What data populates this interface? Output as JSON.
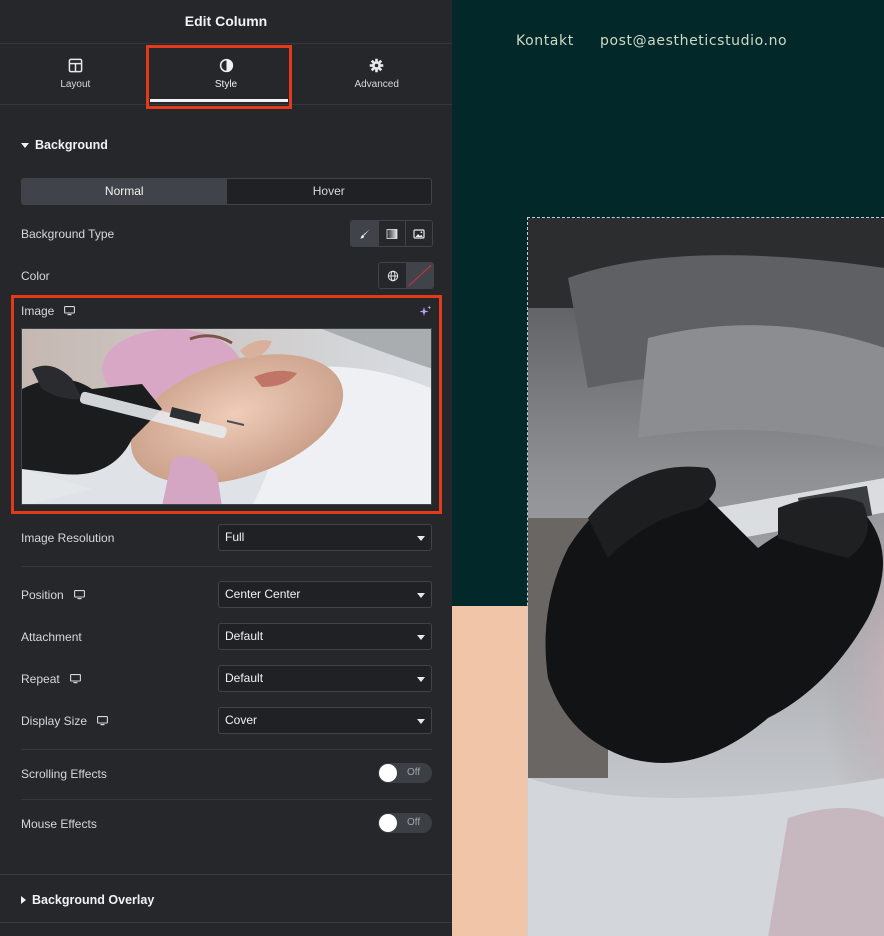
{
  "panel": {
    "title": "Edit Column",
    "tabs": [
      {
        "label": "Layout",
        "icon": "layout-icon"
      },
      {
        "label": "Style",
        "icon": "contrast-icon"
      },
      {
        "label": "Advanced",
        "icon": "gear-icon"
      }
    ],
    "active_tab": "Style",
    "section_background": "Background",
    "state_tabs": [
      "Normal",
      "Hover"
    ],
    "active_state": "Normal",
    "background_type_label": "Background Type",
    "background_type_options": [
      "brush-icon",
      "gradient-icon",
      "image-icon"
    ],
    "color_label": "Color",
    "image_label": "Image",
    "image_resolution_label": "Image Resolution",
    "image_resolution_value": "Full",
    "position_label": "Position",
    "position_value": "Center Center",
    "attachment_label": "Attachment",
    "attachment_value": "Default",
    "repeat_label": "Repeat",
    "repeat_value": "Default",
    "display_size_label": "Display Size",
    "display_size_value": "Cover",
    "scrolling_effects_label": "Scrolling Effects",
    "scrolling_effects_state": "Off",
    "mouse_effects_label": "Mouse Effects",
    "mouse_effects_state": "Off",
    "section_overlay": "Background Overlay"
  },
  "preview": {
    "nav_contact": "Kontakt",
    "nav_email": "post@aestheticstudio.no"
  },
  "colors": {
    "panel_bg": "#26272b",
    "highlight": "#e5391c",
    "preview_bg": "#03282a",
    "accent_peach": "#f0c5a8"
  }
}
